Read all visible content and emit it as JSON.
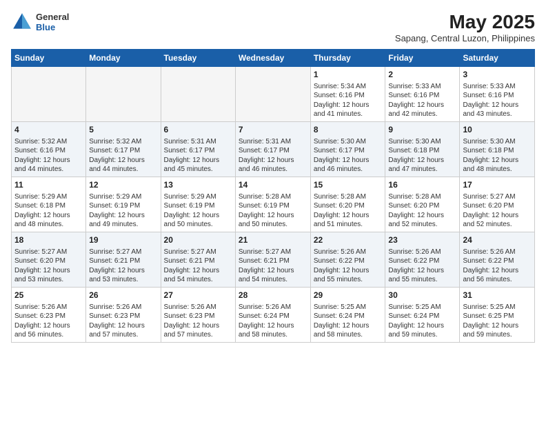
{
  "header": {
    "logo_general": "General",
    "logo_blue": "Blue",
    "month_year": "May 2025",
    "location": "Sapang, Central Luzon, Philippines"
  },
  "weekdays": [
    "Sunday",
    "Monday",
    "Tuesday",
    "Wednesday",
    "Thursday",
    "Friday",
    "Saturday"
  ],
  "weeks": [
    [
      {
        "day": "",
        "empty": true
      },
      {
        "day": "",
        "empty": true
      },
      {
        "day": "",
        "empty": true
      },
      {
        "day": "",
        "empty": true
      },
      {
        "day": "1",
        "sunrise": "5:34 AM",
        "sunset": "6:16 PM",
        "daylight": "12 hours and 41 minutes."
      },
      {
        "day": "2",
        "sunrise": "5:33 AM",
        "sunset": "6:16 PM",
        "daylight": "12 hours and 42 minutes."
      },
      {
        "day": "3",
        "sunrise": "5:33 AM",
        "sunset": "6:16 PM",
        "daylight": "12 hours and 43 minutes."
      }
    ],
    [
      {
        "day": "4",
        "sunrise": "5:32 AM",
        "sunset": "6:16 PM",
        "daylight": "12 hours and 44 minutes."
      },
      {
        "day": "5",
        "sunrise": "5:32 AM",
        "sunset": "6:17 PM",
        "daylight": "12 hours and 44 minutes."
      },
      {
        "day": "6",
        "sunrise": "5:31 AM",
        "sunset": "6:17 PM",
        "daylight": "12 hours and 45 minutes."
      },
      {
        "day": "7",
        "sunrise": "5:31 AM",
        "sunset": "6:17 PM",
        "daylight": "12 hours and 46 minutes."
      },
      {
        "day": "8",
        "sunrise": "5:30 AM",
        "sunset": "6:17 PM",
        "daylight": "12 hours and 46 minutes."
      },
      {
        "day": "9",
        "sunrise": "5:30 AM",
        "sunset": "6:18 PM",
        "daylight": "12 hours and 47 minutes."
      },
      {
        "day": "10",
        "sunrise": "5:30 AM",
        "sunset": "6:18 PM",
        "daylight": "12 hours and 48 minutes."
      }
    ],
    [
      {
        "day": "11",
        "sunrise": "5:29 AM",
        "sunset": "6:18 PM",
        "daylight": "12 hours and 48 minutes."
      },
      {
        "day": "12",
        "sunrise": "5:29 AM",
        "sunset": "6:19 PM",
        "daylight": "12 hours and 49 minutes."
      },
      {
        "day": "13",
        "sunrise": "5:29 AM",
        "sunset": "6:19 PM",
        "daylight": "12 hours and 50 minutes."
      },
      {
        "day": "14",
        "sunrise": "5:28 AM",
        "sunset": "6:19 PM",
        "daylight": "12 hours and 50 minutes."
      },
      {
        "day": "15",
        "sunrise": "5:28 AM",
        "sunset": "6:20 PM",
        "daylight": "12 hours and 51 minutes."
      },
      {
        "day": "16",
        "sunrise": "5:28 AM",
        "sunset": "6:20 PM",
        "daylight": "12 hours and 52 minutes."
      },
      {
        "day": "17",
        "sunrise": "5:27 AM",
        "sunset": "6:20 PM",
        "daylight": "12 hours and 52 minutes."
      }
    ],
    [
      {
        "day": "18",
        "sunrise": "5:27 AM",
        "sunset": "6:20 PM",
        "daylight": "12 hours and 53 minutes."
      },
      {
        "day": "19",
        "sunrise": "5:27 AM",
        "sunset": "6:21 PM",
        "daylight": "12 hours and 53 minutes."
      },
      {
        "day": "20",
        "sunrise": "5:27 AM",
        "sunset": "6:21 PM",
        "daylight": "12 hours and 54 minutes."
      },
      {
        "day": "21",
        "sunrise": "5:27 AM",
        "sunset": "6:21 PM",
        "daylight": "12 hours and 54 minutes."
      },
      {
        "day": "22",
        "sunrise": "5:26 AM",
        "sunset": "6:22 PM",
        "daylight": "12 hours and 55 minutes."
      },
      {
        "day": "23",
        "sunrise": "5:26 AM",
        "sunset": "6:22 PM",
        "daylight": "12 hours and 55 minutes."
      },
      {
        "day": "24",
        "sunrise": "5:26 AM",
        "sunset": "6:22 PM",
        "daylight": "12 hours and 56 minutes."
      }
    ],
    [
      {
        "day": "25",
        "sunrise": "5:26 AM",
        "sunset": "6:23 PM",
        "daylight": "12 hours and 56 minutes."
      },
      {
        "day": "26",
        "sunrise": "5:26 AM",
        "sunset": "6:23 PM",
        "daylight": "12 hours and 57 minutes."
      },
      {
        "day": "27",
        "sunrise": "5:26 AM",
        "sunset": "6:23 PM",
        "daylight": "12 hours and 57 minutes."
      },
      {
        "day": "28",
        "sunrise": "5:26 AM",
        "sunset": "6:24 PM",
        "daylight": "12 hours and 58 minutes."
      },
      {
        "day": "29",
        "sunrise": "5:25 AM",
        "sunset": "6:24 PM",
        "daylight": "12 hours and 58 minutes."
      },
      {
        "day": "30",
        "sunrise": "5:25 AM",
        "sunset": "6:24 PM",
        "daylight": "12 hours and 59 minutes."
      },
      {
        "day": "31",
        "sunrise": "5:25 AM",
        "sunset": "6:25 PM",
        "daylight": "12 hours and 59 minutes."
      }
    ]
  ]
}
